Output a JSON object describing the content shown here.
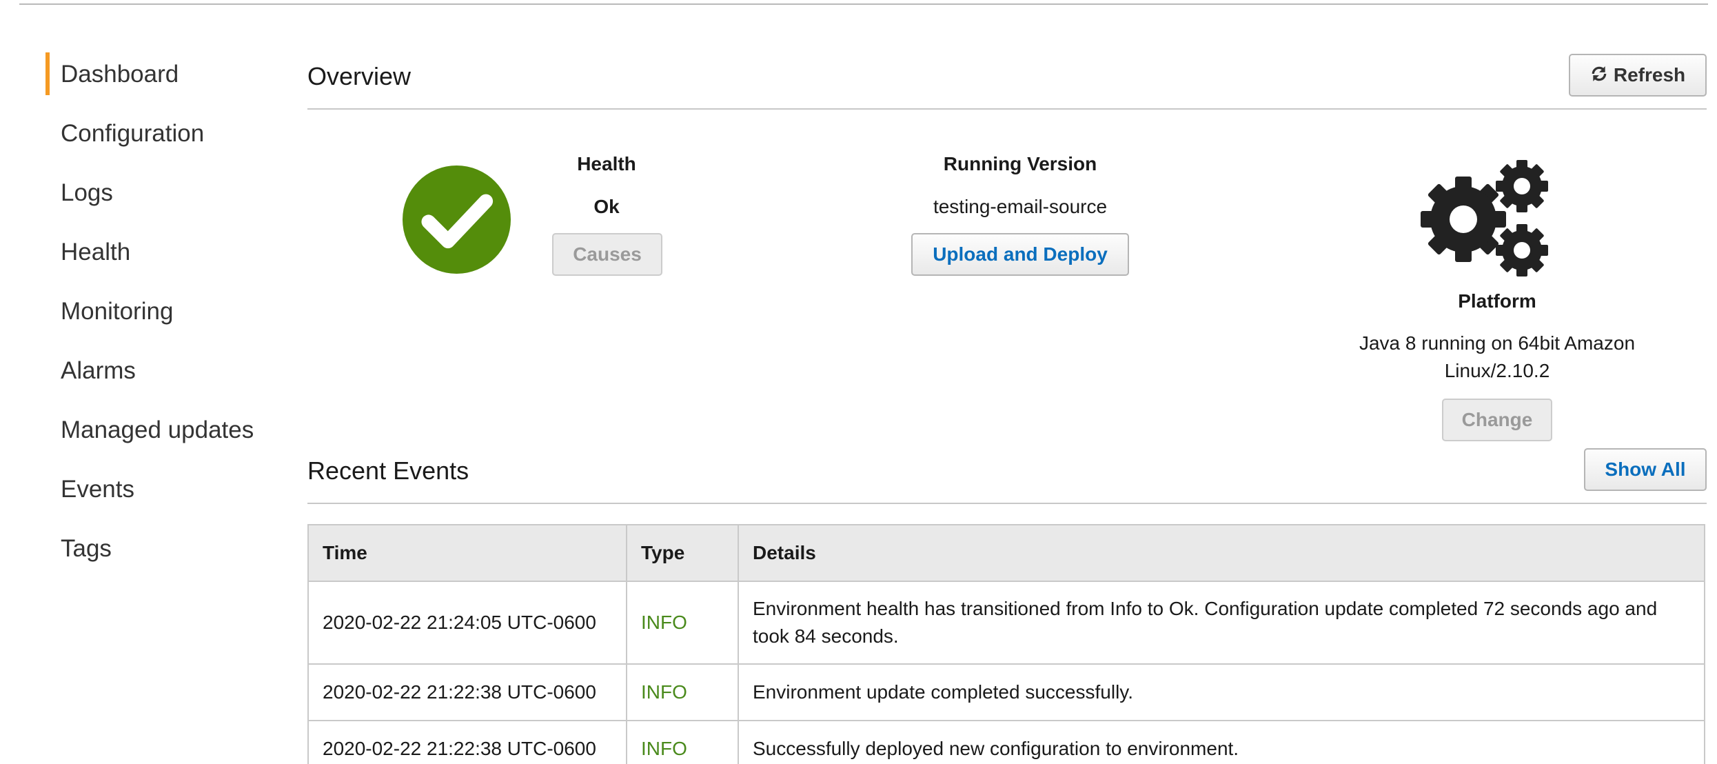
{
  "sidebar": {
    "items": [
      {
        "label": "Dashboard",
        "active": true
      },
      {
        "label": "Configuration"
      },
      {
        "label": "Logs"
      },
      {
        "label": "Health"
      },
      {
        "label": "Monitoring"
      },
      {
        "label": "Alarms"
      },
      {
        "label": "Managed updates"
      },
      {
        "label": "Events"
      },
      {
        "label": "Tags"
      }
    ]
  },
  "overview": {
    "title": "Overview",
    "refresh_label": "Refresh",
    "health": {
      "heading": "Health",
      "status": "Ok",
      "causes_label": "Causes",
      "icon": "check-circle-icon",
      "color": "#548d0b"
    },
    "running_version": {
      "heading": "Running Version",
      "value": "testing-email-source",
      "upload_label": "Upload and Deploy"
    },
    "platform": {
      "heading": "Platform",
      "value_line1": "Java 8 running on 64bit Amazon",
      "value_line2": "Linux/2.10.2",
      "change_label": "Change",
      "icon": "gears-icon"
    }
  },
  "events": {
    "title": "Recent Events",
    "show_all_label": "Show All",
    "columns": [
      "Time",
      "Type",
      "Details"
    ],
    "rows": [
      {
        "time": "2020-02-22 21:24:05 UTC-0600",
        "type": "INFO",
        "details": "Environment health has transitioned from Info to Ok. Configuration update completed 72 seconds ago and took 84 seconds."
      },
      {
        "time": "2020-02-22 21:22:38 UTC-0600",
        "type": "INFO",
        "details": "Environment update completed successfully."
      },
      {
        "time": "2020-02-22 21:22:38 UTC-0600",
        "type": "INFO",
        "details": "Successfully deployed new configuration to environment."
      }
    ]
  },
  "colors": {
    "accent": "#f59a23",
    "link_blue": "#0a6ebd",
    "info_green": "#4a8a1c"
  }
}
